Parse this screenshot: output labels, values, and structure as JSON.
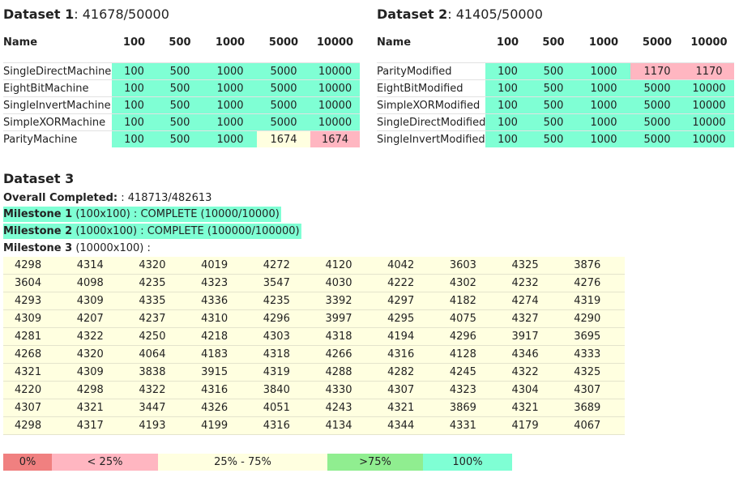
{
  "dataset1": {
    "title": "Dataset 1",
    "score": ": 41678/50000",
    "headers": [
      "Name",
      "100",
      "500",
      "1000",
      "5000",
      "10000"
    ],
    "rows": [
      {
        "name": "SingleDirectMachine",
        "cells": [
          {
            "v": "100",
            "s": "g"
          },
          {
            "v": "500",
            "s": "g"
          },
          {
            "v": "1000",
            "s": "g"
          },
          {
            "v": "5000",
            "s": "g"
          },
          {
            "v": "10000",
            "s": "g"
          }
        ]
      },
      {
        "name": "EightBitMachine",
        "cells": [
          {
            "v": "100",
            "s": "g"
          },
          {
            "v": "500",
            "s": "g"
          },
          {
            "v": "1000",
            "s": "g"
          },
          {
            "v": "5000",
            "s": "g"
          },
          {
            "v": "10000",
            "s": "g"
          }
        ]
      },
      {
        "name": "SingleInvertMachine",
        "cells": [
          {
            "v": "100",
            "s": "g"
          },
          {
            "v": "500",
            "s": "g"
          },
          {
            "v": "1000",
            "s": "g"
          },
          {
            "v": "5000",
            "s": "g"
          },
          {
            "v": "10000",
            "s": "g"
          }
        ]
      },
      {
        "name": "SimpleXORMachine",
        "cells": [
          {
            "v": "100",
            "s": "g"
          },
          {
            "v": "500",
            "s": "g"
          },
          {
            "v": "1000",
            "s": "g"
          },
          {
            "v": "5000",
            "s": "g"
          },
          {
            "v": "10000",
            "s": "g"
          }
        ]
      },
      {
        "name": "ParityMachine",
        "cells": [
          {
            "v": "100",
            "s": "g"
          },
          {
            "v": "500",
            "s": "g"
          },
          {
            "v": "1000",
            "s": "g"
          },
          {
            "v": "1674",
            "s": "y"
          },
          {
            "v": "1674",
            "s": "p"
          }
        ]
      }
    ]
  },
  "dataset2": {
    "title": "Dataset 2",
    "score": ": 41405/50000",
    "headers": [
      "Name",
      "100",
      "500",
      "1000",
      "5000",
      "10000"
    ],
    "rows": [
      {
        "name": "ParityModified",
        "cells": [
          {
            "v": "100",
            "s": "g"
          },
          {
            "v": "500",
            "s": "g"
          },
          {
            "v": "1000",
            "s": "g"
          },
          {
            "v": "1170",
            "s": "p"
          },
          {
            "v": "1170",
            "s": "p"
          }
        ]
      },
      {
        "name": "EightBitModified",
        "cells": [
          {
            "v": "100",
            "s": "g"
          },
          {
            "v": "500",
            "s": "g"
          },
          {
            "v": "1000",
            "s": "g"
          },
          {
            "v": "5000",
            "s": "g"
          },
          {
            "v": "10000",
            "s": "g"
          }
        ]
      },
      {
        "name": "SimpleXORModified",
        "cells": [
          {
            "v": "100",
            "s": "g"
          },
          {
            "v": "500",
            "s": "g"
          },
          {
            "v": "1000",
            "s": "g"
          },
          {
            "v": "5000",
            "s": "g"
          },
          {
            "v": "10000",
            "s": "g"
          }
        ]
      },
      {
        "name": "SingleDirectModified",
        "cells": [
          {
            "v": "100",
            "s": "g"
          },
          {
            "v": "500",
            "s": "g"
          },
          {
            "v": "1000",
            "s": "g"
          },
          {
            "v": "5000",
            "s": "g"
          },
          {
            "v": "10000",
            "s": "g"
          }
        ]
      },
      {
        "name": "SingleInvertModified",
        "cells": [
          {
            "v": "100",
            "s": "g"
          },
          {
            "v": "500",
            "s": "g"
          },
          {
            "v": "1000",
            "s": "g"
          },
          {
            "v": "5000",
            "s": "g"
          },
          {
            "v": "10000",
            "s": "g"
          }
        ]
      }
    ]
  },
  "dataset3": {
    "title": "Dataset 3",
    "overall_label": "Overall Completed:",
    "overall_value": ": 418713/482613",
    "milestone1_label": "Milestone 1",
    "milestone1_text": " (100x100) : COMPLETE (10000/10000)",
    "milestone2_label": "Milestone 2",
    "milestone2_text": " (1000x100) : COMPLETE (100000/100000)",
    "milestone3_label": "Milestone 3",
    "milestone3_text": " (10000x100) :",
    "grid": [
      [
        "4298",
        "4314",
        "4320",
        "4019",
        "4272",
        "4120",
        "4042",
        "3603",
        "4325",
        "3876"
      ],
      [
        "3604",
        "4098",
        "4235",
        "4323",
        "3547",
        "4030",
        "4222",
        "4302",
        "4232",
        "4276"
      ],
      [
        "4293",
        "4309",
        "4335",
        "4336",
        "4235",
        "3392",
        "4297",
        "4182",
        "4274",
        "4319"
      ],
      [
        "4309",
        "4207",
        "4237",
        "4310",
        "4296",
        "3997",
        "4295",
        "4075",
        "4327",
        "4290"
      ],
      [
        "4281",
        "4322",
        "4250",
        "4218",
        "4303",
        "4318",
        "4194",
        "4296",
        "3917",
        "3695"
      ],
      [
        "4268",
        "4320",
        "4064",
        "4183",
        "4318",
        "4266",
        "4316",
        "4128",
        "4346",
        "4333"
      ],
      [
        "4321",
        "4309",
        "3838",
        "3915",
        "4319",
        "4288",
        "4282",
        "4245",
        "4322",
        "4325"
      ],
      [
        "4220",
        "4298",
        "4322",
        "4316",
        "3840",
        "4330",
        "4307",
        "4323",
        "4304",
        "4307"
      ],
      [
        "4307",
        "4321",
        "3447",
        "4326",
        "4051",
        "4243",
        "4321",
        "3869",
        "4321",
        "3689"
      ],
      [
        "4298",
        "4317",
        "4193",
        "4199",
        "4316",
        "4134",
        "4344",
        "4331",
        "4179",
        "4067"
      ]
    ]
  },
  "legend": [
    {
      "label": "0%",
      "color": "#f08080"
    },
    {
      "label": "< 25%",
      "color": "#ffb6c1"
    },
    {
      "label": "25% - 75%",
      "color": "#ffffe0"
    },
    {
      "label": ">75%",
      "color": "#90ee90"
    },
    {
      "label": "100%",
      "color": "#7fffd4"
    }
  ]
}
